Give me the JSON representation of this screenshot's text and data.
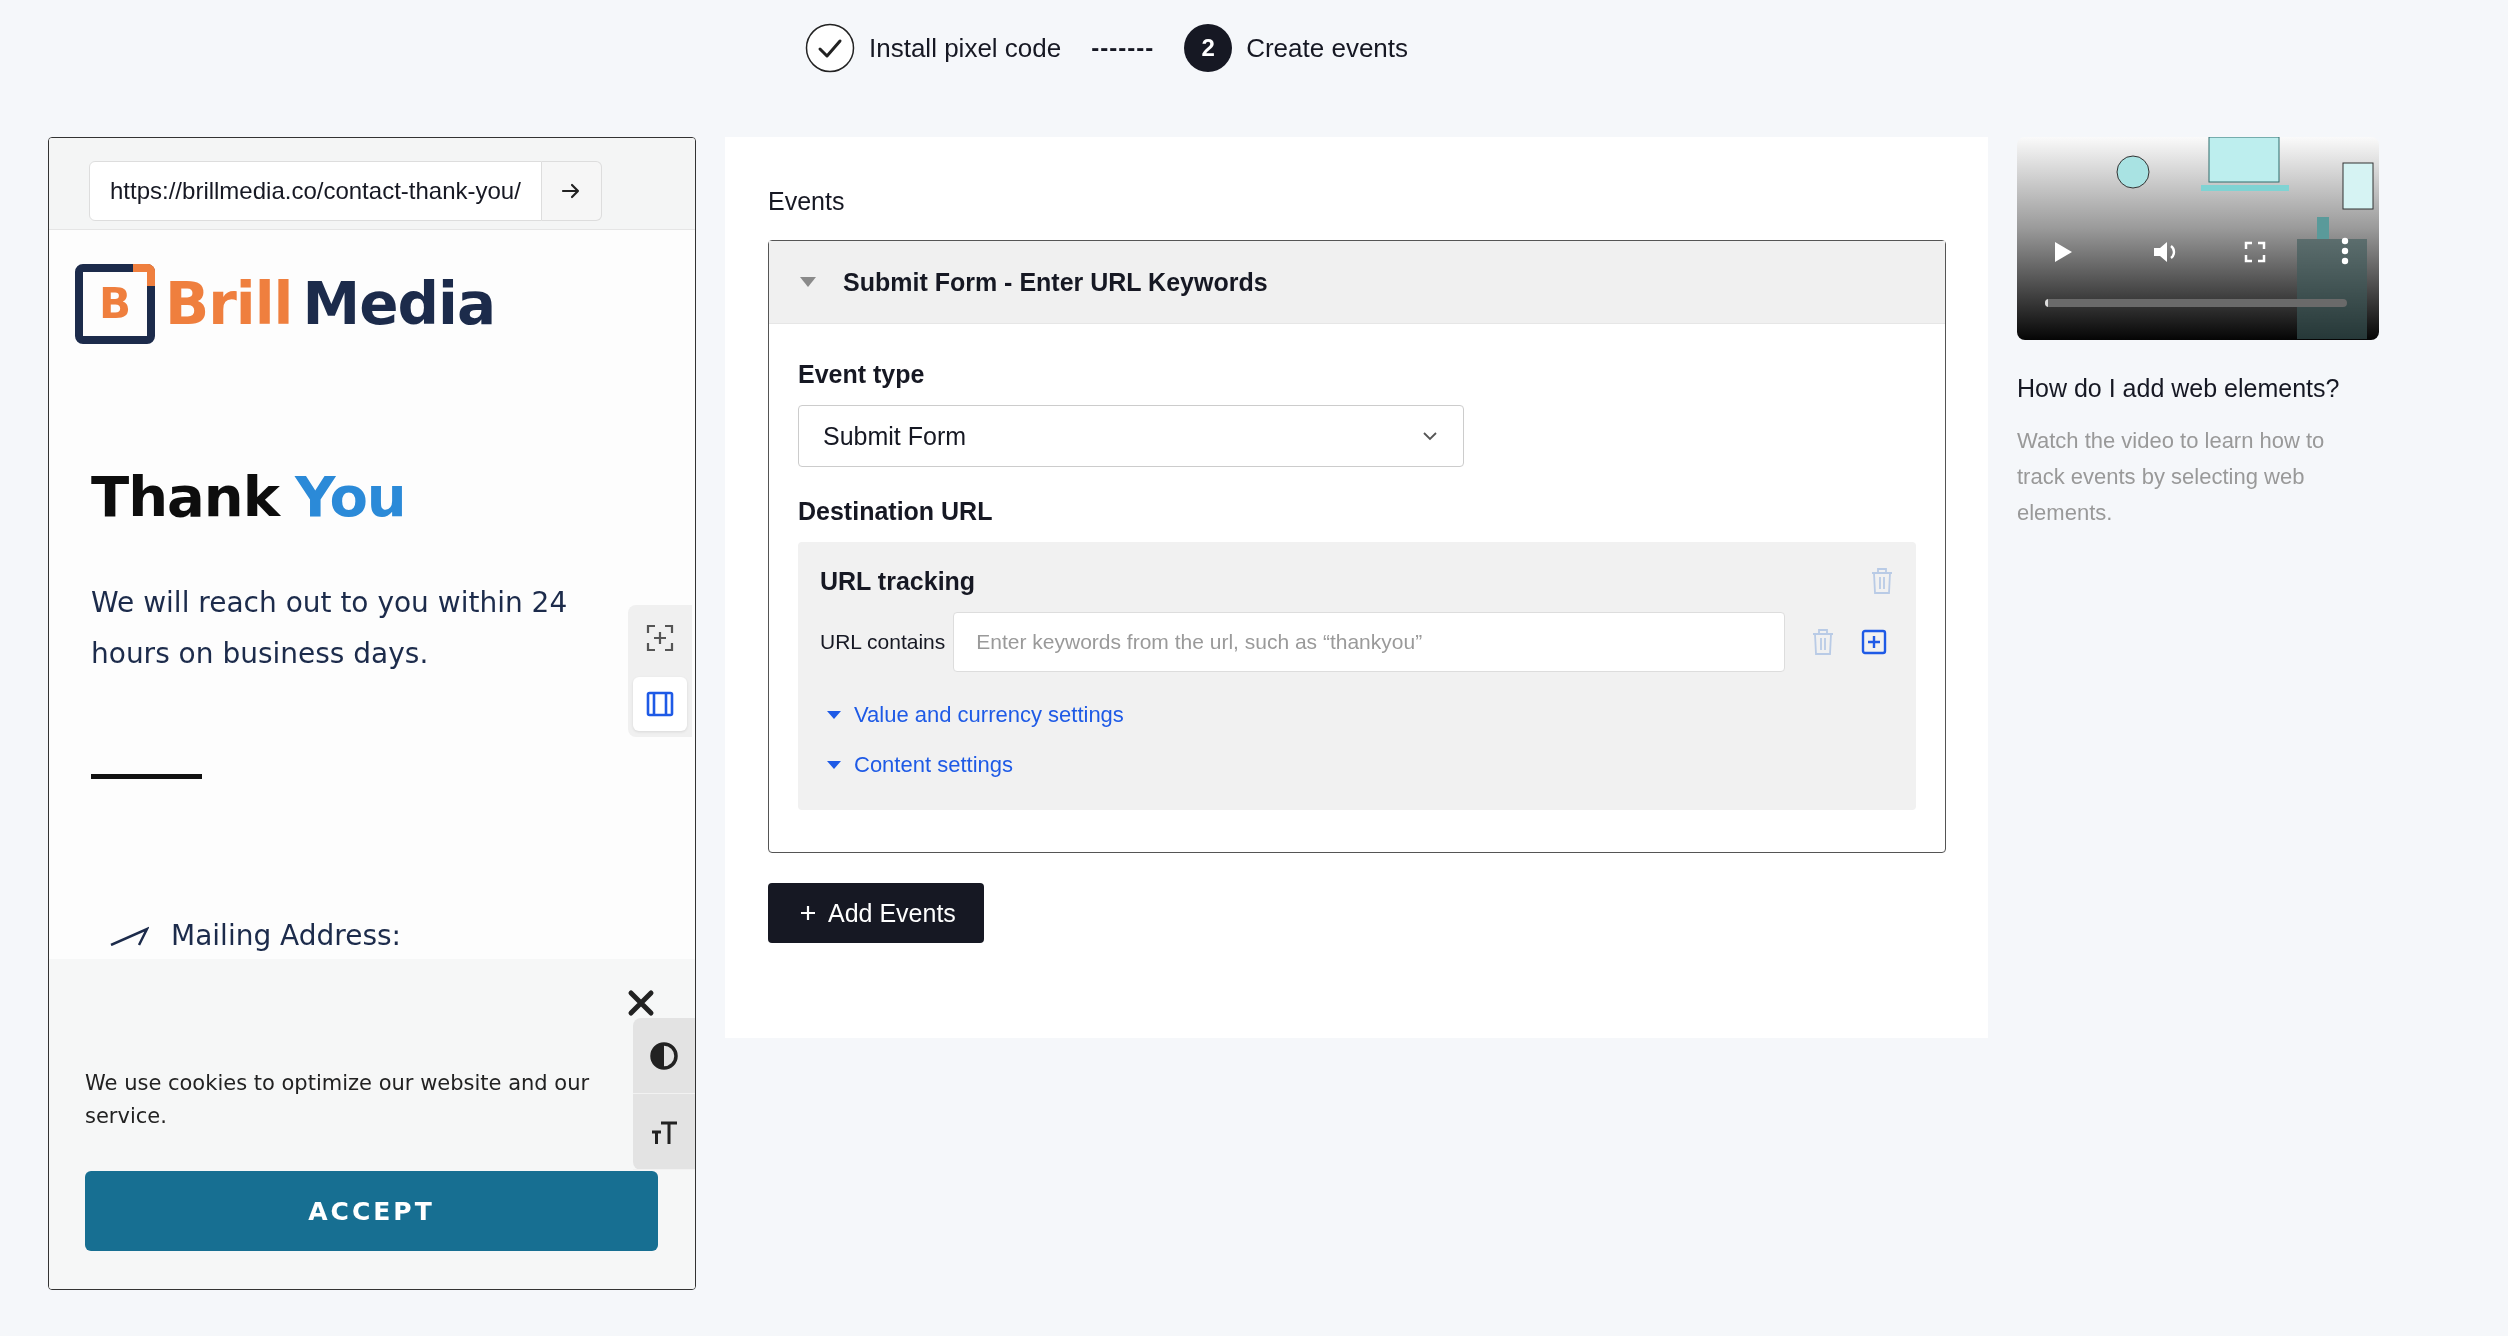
{
  "stepper": {
    "steps": [
      {
        "label": "Install pixel code",
        "completed": true
      },
      {
        "label": "Create events",
        "completed": false,
        "number": "2"
      }
    ],
    "separator": "-------"
  },
  "preview": {
    "url": "https://brillmedia.co/contact-thank-you/",
    "logo": {
      "mark": "B",
      "words": [
        {
          "text": "Brill",
          "color": "#ef7f3e"
        },
        {
          "text": "Media",
          "color": "#1c2b4b"
        }
      ]
    },
    "heading": [
      {
        "text": "Thank",
        "accent": false
      },
      {
        "text": "You",
        "accent": true
      }
    ],
    "message": "We will reach out to you within 24 hours on business days.",
    "mailing_label": "Mailing Address:",
    "tools": [
      {
        "kind": "select-element",
        "selected": false
      },
      {
        "kind": "columns",
        "selected": true
      }
    ],
    "cookie": {
      "text": "We use cookies to optimize our website and our service.",
      "button": "ACCEPT"
    },
    "accessibility": [
      {
        "kind": "contrast"
      },
      {
        "kind": "text-size"
      }
    ]
  },
  "events": {
    "title": "Events",
    "event": {
      "title": "Submit Form - Enter URL Keywords",
      "expanded": true,
      "event_type_label": "Event type",
      "event_type": "Submit Form",
      "destination_label": "Destination URL",
      "tracking": {
        "title": "URL tracking",
        "rule_label": "URL contains",
        "placeholder": "Enter keywords from the url, such as “thankyou”",
        "links": [
          "Value and currency settings",
          "Content settings"
        ]
      }
    },
    "add_button": "Add Events"
  },
  "help": {
    "video": {
      "kind": "picture",
      "progress": {
        "level": 0.01
      }
    },
    "title": "How do I add web elements?",
    "text": "Watch the video to learn how to track events by selecting web elements."
  }
}
